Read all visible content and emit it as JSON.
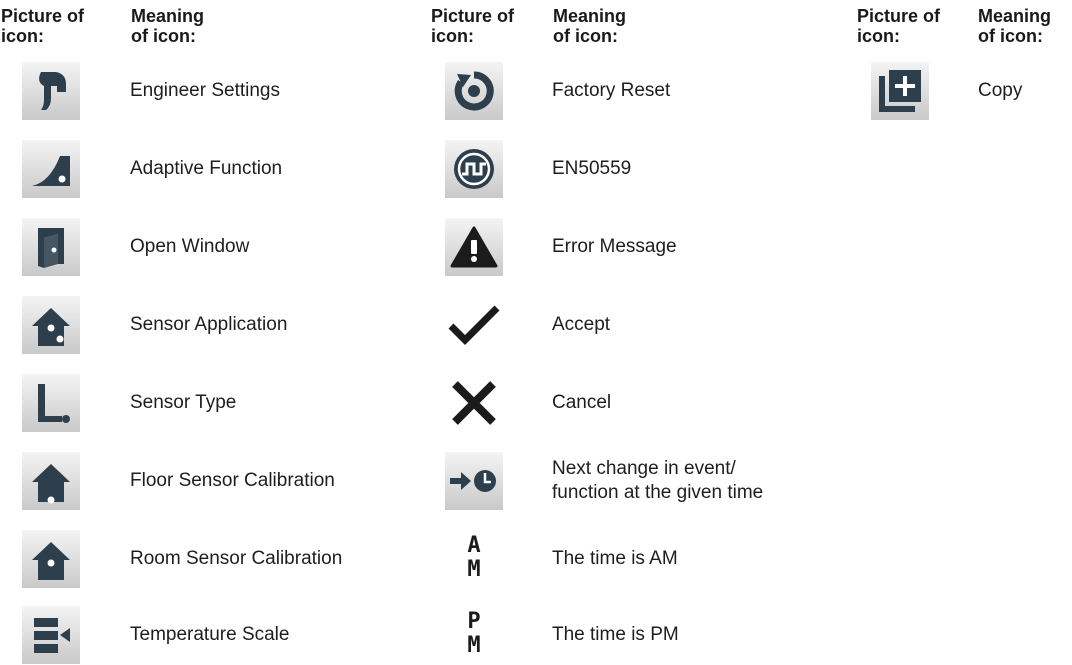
{
  "columns": [
    {
      "header_picture": [
        "Picture of",
        "icon:"
      ],
      "header_meaning": [
        "Meaning",
        "of icon:"
      ],
      "items": [
        {
          "icon": "wrench-icon",
          "label": "Engineer Settings"
        },
        {
          "icon": "adaptive-ramp-icon",
          "label": "Adaptive Function"
        },
        {
          "icon": "open-window-icon",
          "label": "Open Window"
        },
        {
          "icon": "house-sensor-icon",
          "label": "Sensor Application"
        },
        {
          "icon": "sensor-type-icon",
          "label": "Sensor Type"
        },
        {
          "icon": "floor-sensor-house-icon",
          "label": "Floor Sensor Calibration"
        },
        {
          "icon": "room-sensor-house-icon",
          "label": "Room Sensor Calibration"
        },
        {
          "icon": "temperature-scale-icon",
          "label": "Temperature Scale"
        }
      ]
    },
    {
      "header_picture": [
        "Picture of",
        "icon:"
      ],
      "header_meaning": [
        "Meaning",
        "of icon:"
      ],
      "items": [
        {
          "icon": "factory-reset-icon",
          "label": "Factory Reset"
        },
        {
          "icon": "en50559-icon",
          "label": "EN50559"
        },
        {
          "icon": "warning-icon",
          "label": "Error Message"
        },
        {
          "icon": "checkmark-icon",
          "label": "Accept"
        },
        {
          "icon": "cross-icon",
          "label": "Cancel"
        },
        {
          "icon": "arrow-clock-icon",
          "label": "Next change in event/\nfunction at the given time"
        },
        {
          "icon": "am-icon",
          "label": "The time is AM",
          "glyph": [
            "A",
            "M"
          ]
        },
        {
          "icon": "pm-icon",
          "label": "The time is PM",
          "glyph": [
            "P",
            "M"
          ]
        }
      ]
    },
    {
      "header_picture": [
        "Picture of",
        "icon:"
      ],
      "header_meaning": [
        "Meaning",
        "of icon:"
      ],
      "items": [
        {
          "icon": "copy-icon",
          "label": "Copy"
        }
      ]
    }
  ]
}
